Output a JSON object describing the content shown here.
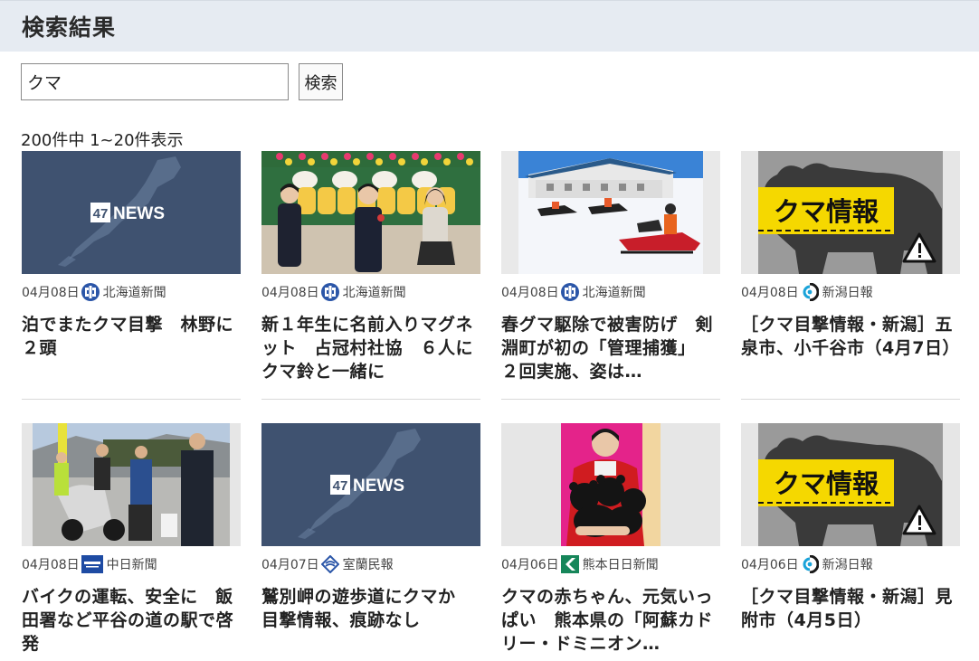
{
  "header": {
    "title": "検索結果"
  },
  "search": {
    "value": "クマ",
    "button_label": "検索"
  },
  "results": {
    "count_text": "200件中 1~20件表示",
    "items": [
      {
        "thumb": "47news",
        "date": "04月08日",
        "source": "北海道新聞",
        "source_icon": "hokkaido-shimbun-logo",
        "title": "泊でまたクマ目撃　林野に２頭"
      },
      {
        "thumb": "school-kids",
        "date": "04月08日",
        "source": "北海道新聞",
        "source_icon": "hokkaido-shimbun-logo",
        "title": "新１年生に名前入りマグネット　占冠村社協　６人にクマ鈴と一緒に"
      },
      {
        "thumb": "snowmobile",
        "date": "04月08日",
        "source": "北海道新聞",
        "source_icon": "hokkaido-shimbun-logo",
        "title": "春グマ駆除で被害防げ　剣淵町が初の「管理捕獲」　２回実施、姿は…"
      },
      {
        "thumb": "bear-info",
        "date": "04月08日",
        "source": "新潟日報",
        "source_icon": "niigata-nippo-logo",
        "title": "［クマ目撃情報・新潟］五泉市、小千谷市（4月7日）",
        "badge": "クマ情報"
      },
      {
        "thumb": "police-bike",
        "date": "04月08日",
        "source": "中日新聞",
        "source_icon": "chunichi-logo",
        "title": "バイクの運転、安全に　飯田署など平谷の道の駅で啓発"
      },
      {
        "thumb": "47news",
        "date": "04月07日",
        "source": "室蘭民報",
        "source_icon": "muroran-minpo-logo",
        "title": "鷲別岬の遊歩道にクマか　目撃情報、痕跡なし"
      },
      {
        "thumb": "bear-cubs",
        "date": "04月06日",
        "source": "熊本日日新聞",
        "source_icon": "kumanichi-logo",
        "title": "クマの赤ちゃん、元気いっぱい　熊本県の「阿蘇カドリー・ドミニオン…"
      },
      {
        "thumb": "bear-info",
        "date": "04月06日",
        "source": "新潟日報",
        "source_icon": "niigata-nippo-logo",
        "title": "［クマ目撃情報・新潟］見附市（4月5日）",
        "badge": "クマ情報"
      }
    ],
    "logo_text": "47NEWS"
  },
  "colors": {
    "header_bg": "#e6ebf2",
    "news_bg": "#3f5270",
    "bear_badge": "#f5d800"
  }
}
